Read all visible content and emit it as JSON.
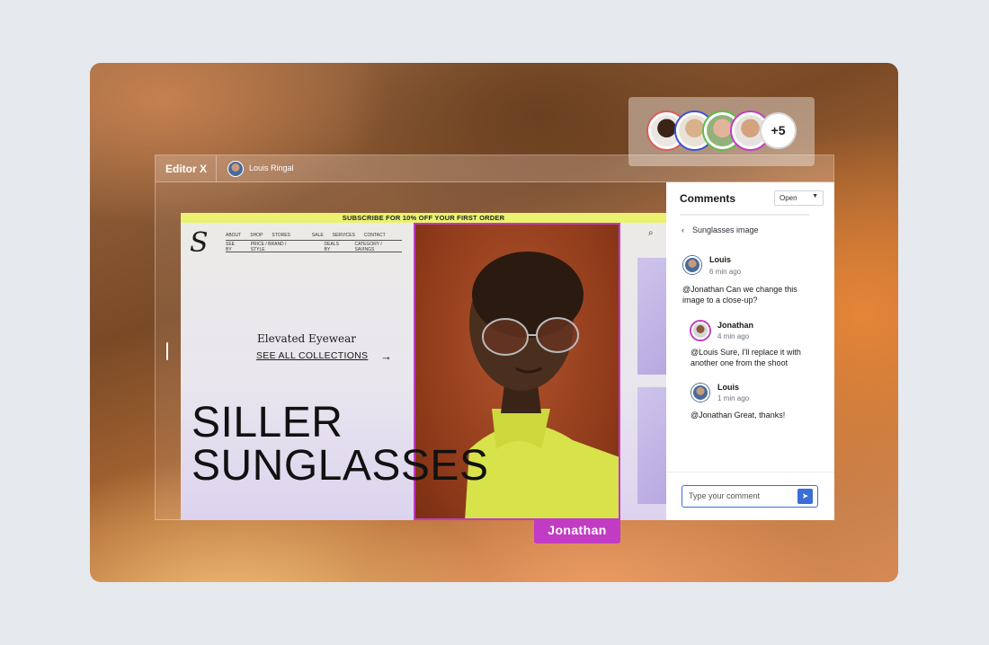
{
  "editor": {
    "brand": "Editor X",
    "user_name": "Louis Ringal"
  },
  "site": {
    "promo": "SUBSCRIBE FOR 10% OFF YOUR FIRST ORDER",
    "logo": "S",
    "nav_row1": [
      "ABOUT",
      "SHOP",
      "STORES",
      "SALE",
      "SERVICES",
      "CONTACT"
    ],
    "nav_row2a": [
      "SEE BY",
      "PRICE / BRAND / STYLE"
    ],
    "nav_row2b": [
      "DEALS BY",
      "CATEGORY / SAVINGS"
    ],
    "tagline": "Elevated Eyewear",
    "collections_link": "SEE ALL COLLECTIONS",
    "hero_line1": "SILLER",
    "hero_line2": "SUNGLASSES"
  },
  "comments": {
    "title": "Comments",
    "status": "Open",
    "thread_title": "Sunglasses image",
    "items": [
      {
        "author": "Louis",
        "time": "6 min ago",
        "text": "@Jonathan Can we change this image to a close-up?"
      },
      {
        "author": "Jonathan",
        "time": "4 min ago",
        "text": "@Louis Sure, I'll replace it with another one from the shoot"
      },
      {
        "author": "Louis",
        "time": "1 min ago",
        "text": "@Jonathan Great, thanks!"
      }
    ],
    "input_placeholder": "Type your comment"
  },
  "selection_label": "Jonathan",
  "collaborators": {
    "more_count": "+5",
    "ring_colors": [
      "#e05a5a",
      "#3b4fd8",
      "#5cbf4a",
      "#c23bc4"
    ]
  },
  "colors": {
    "accent": "#c23bc4",
    "primary": "#3b6dd8",
    "promo": "#eaf270"
  }
}
